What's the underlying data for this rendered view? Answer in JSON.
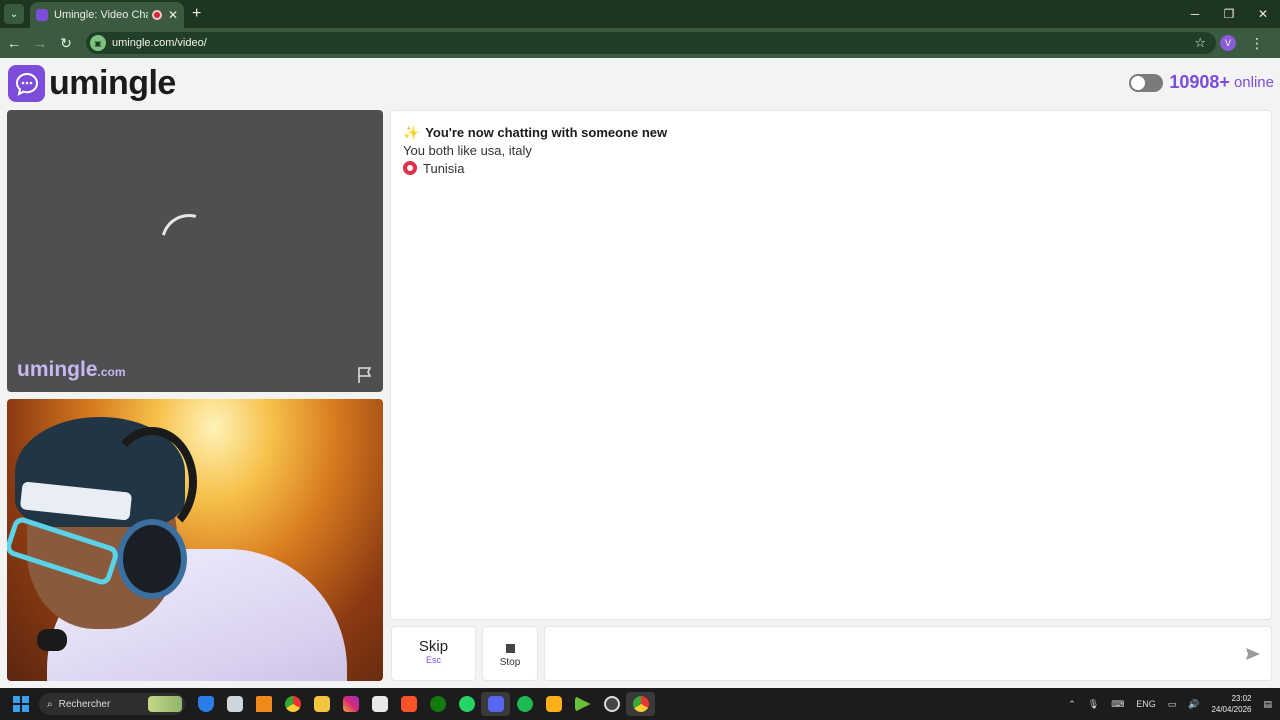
{
  "browser": {
    "tab_title": "Umingle: Video Chat with S",
    "url": "umingle.com/video/",
    "profile_initial": "V"
  },
  "app": {
    "logo_text": "umingle",
    "online_count": "10908+",
    "online_label": "online",
    "watermark_main": "umingle",
    "watermark_suffix": ".com"
  },
  "chat": {
    "messages": [
      "You're now chatting with someone new",
      "You both like usa, italy",
      "Tunisia"
    ]
  },
  "controls": {
    "skip_label": "Skip",
    "skip_hint": "Esc",
    "stop_label": "Stop",
    "message_placeholder": ""
  },
  "taskbar": {
    "search_label": "Rechercher",
    "language": "ENG",
    "time": "23:02",
    "date": "24/04/2026"
  },
  "colors": {
    "accent": "#7c4ddb",
    "browser_frame": "#1e3520"
  }
}
